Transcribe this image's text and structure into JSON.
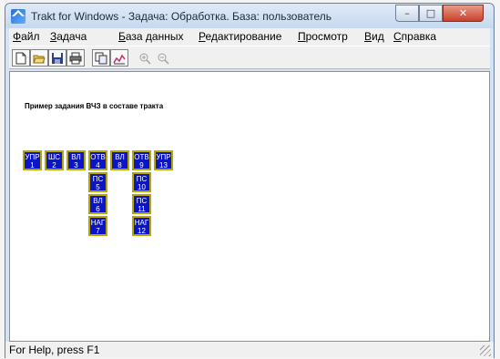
{
  "window": {
    "title": "Trakt for Windows - Задача: Обработка. База: пользователь",
    "controls": {
      "minimize": "–",
      "maximize": "□",
      "close": "✕"
    }
  },
  "menu": [
    {
      "first": "Ф",
      "rest": "айл"
    },
    {
      "first": "З",
      "rest": "адача"
    },
    {
      "first": "Б",
      "rest": "аза данных"
    },
    {
      "first": "Р",
      "rest": "едактирование"
    },
    {
      "first": "П",
      "rest": "росмотр"
    },
    {
      "first": "В",
      "rest": "ид"
    },
    {
      "first": "С",
      "rest": "правка"
    }
  ],
  "toolbar": {
    "icons": [
      "new-file-icon",
      "open-folder-icon",
      "save-icon",
      "print-icon",
      "copy-icon",
      "chart-icon",
      "zoom-in-icon",
      "zoom-out-icon"
    ]
  },
  "canvas": {
    "caption": "Пример задания ВЧЗ в составе тракта",
    "blocks": [
      {
        "name": "УПР",
        "num": "1"
      },
      {
        "name": "ШС",
        "num": "2"
      },
      {
        "name": "ВЛ",
        "num": "3"
      },
      {
        "name": "ОТВ",
        "num": "4"
      },
      {
        "name": "ВЛ",
        "num": "8"
      },
      {
        "name": "ОТВ",
        "num": "9"
      },
      {
        "name": "УПР",
        "num": "13"
      },
      {
        "name": "ПС",
        "num": "5"
      },
      {
        "name": "ВЛ",
        "num": "6"
      },
      {
        "name": "НАГ",
        "num": "7"
      },
      {
        "name": "ПС",
        "num": "10"
      },
      {
        "name": "ПС",
        "num": "11"
      },
      {
        "name": "НАГ",
        "num": "12"
      }
    ],
    "colors": {
      "block_fill": "#0a14c8",
      "block_border": "#b7a800"
    }
  },
  "status": {
    "text": "For Help, press F1"
  }
}
